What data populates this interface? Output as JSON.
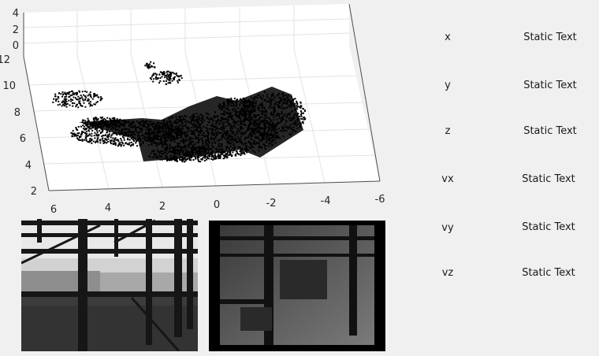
{
  "plot": {
    "z_ticks": [
      "4",
      "2",
      "0"
    ],
    "y_ticks": [
      "12",
      "10",
      "8",
      "6",
      "4",
      "2"
    ],
    "x_ticks": [
      "6",
      "4",
      "2",
      "0",
      "-2",
      "-4",
      "-6"
    ]
  },
  "readouts": [
    {
      "label": "x",
      "value": "Static Text"
    },
    {
      "label": "y",
      "value": "Static Text"
    },
    {
      "label": "z",
      "value": "Static Text"
    },
    {
      "label": "vx",
      "value": "Static Text"
    },
    {
      "label": "vy",
      "value": "Static Text"
    },
    {
      "label": "vz",
      "value": "Static Text"
    }
  ]
}
